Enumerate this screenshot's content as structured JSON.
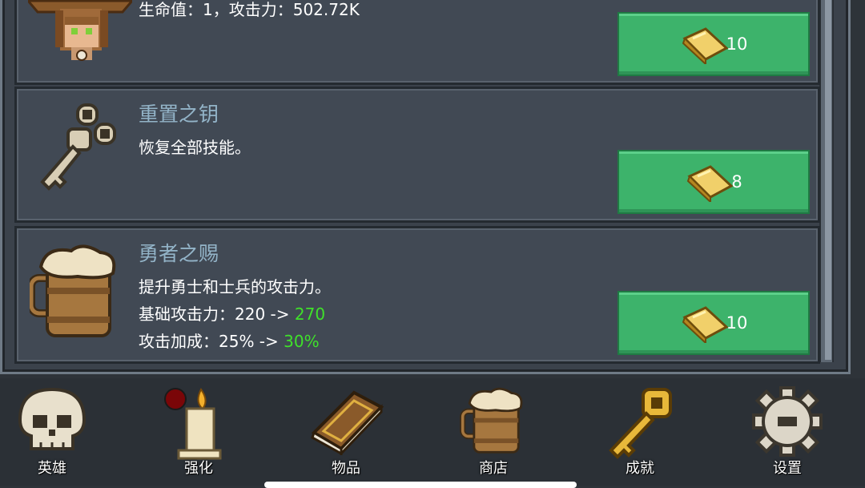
{
  "items": [
    {
      "title": "",
      "lines": [
        {
          "text": "生命值：1，攻击力：502.72K"
        }
      ],
      "price": "10",
      "icon": "witch-portrait-icon"
    },
    {
      "title": "重置之钥",
      "lines": [
        {
          "text": "恢复全部技能。"
        }
      ],
      "price": "8",
      "icon": "reset-key-icon"
    },
    {
      "title": "勇者之赐",
      "lines": [
        {
          "text": "提升勇士和士兵的攻击力。"
        },
        {
          "text": "基础攻击力：220 -> ",
          "highlight": "270"
        },
        {
          "text": "攻击加成：25% -> ",
          "highlight": "30%"
        }
      ],
      "price": "10",
      "icon": "beer-mug-icon"
    }
  ],
  "nav": [
    {
      "label": "英雄",
      "icon": "skull-icon"
    },
    {
      "label": "强化",
      "icon": "candle-icon"
    },
    {
      "label": "物品",
      "icon": "book-icon"
    },
    {
      "label": "商店",
      "icon": "beer-mug-icon"
    },
    {
      "label": "成就",
      "icon": "golden-key-icon"
    },
    {
      "label": "设置",
      "icon": "gear-icon"
    }
  ],
  "colors": {
    "button": "#3db36b",
    "title": "#93b4c8",
    "highlight": "#3fe12a",
    "gold": "#e8c25a"
  }
}
